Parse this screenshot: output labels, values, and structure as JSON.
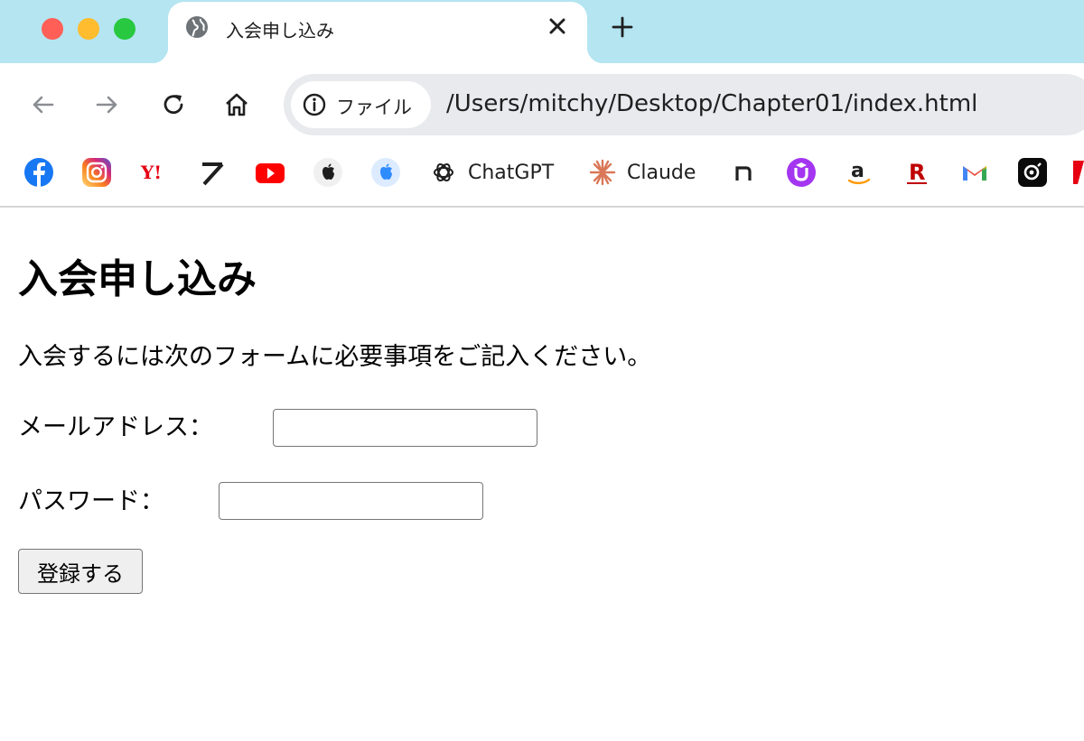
{
  "tab": {
    "title": "入会申し込み",
    "favicon": "globe-icon"
  },
  "toolbar": {
    "icons": [
      "back-arrow-icon",
      "forward-arrow-icon",
      "reload-icon",
      "home-icon"
    ],
    "chip_label": "ファイル",
    "url": "/Users/mitchy/Desktop/Chapter01/index.html"
  },
  "bookmarks": [
    {
      "icon": "facebook-icon",
      "label": ""
    },
    {
      "icon": "instagram-icon",
      "label": ""
    },
    {
      "icon": "yahoo-icon",
      "label": ""
    },
    {
      "icon": "arrow-logo-icon",
      "label": ""
    },
    {
      "icon": "youtube-icon",
      "label": ""
    },
    {
      "icon": "apple-icon",
      "label": ""
    },
    {
      "icon": "apple-blue-icon",
      "label": ""
    },
    {
      "icon": "chatgpt-icon",
      "label": "ChatGPT"
    },
    {
      "icon": "claude-icon",
      "label": "Claude"
    },
    {
      "icon": "note-icon",
      "label": ""
    },
    {
      "icon": "udemy-icon",
      "label": ""
    },
    {
      "icon": "amazon-icon",
      "label": ""
    },
    {
      "icon": "rakuten-icon",
      "label": ""
    },
    {
      "icon": "gmail-icon",
      "label": ""
    },
    {
      "icon": "app-icon",
      "label": ""
    },
    {
      "icon": "partial-icon",
      "label": ""
    }
  ],
  "page": {
    "title": "入会申し込み",
    "intro": "入会するには次のフォームに必要事項をご記入ください。",
    "email_label": "メールアドレス：",
    "email_value": "",
    "password_label": "パスワード：",
    "password_value": "",
    "submit_label": "登録する"
  },
  "colors": {
    "titlebar": "#b4e5f1",
    "close": "#ff5f57",
    "minimize": "#febc2e",
    "maximize": "#28c840",
    "omnibox": "#e8eaed"
  }
}
